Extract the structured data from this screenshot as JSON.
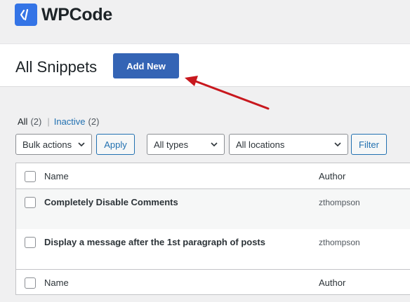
{
  "brand": {
    "logo_text_a": "WP",
    "logo_text_b": "Code",
    "accent": "#3474e6"
  },
  "header": {
    "title": "All Snippets",
    "add_new_label": "Add New",
    "button_color": "#3464b5"
  },
  "annotation": {
    "arrow_color": "#c8181e"
  },
  "filters": {
    "all_label": "All",
    "all_count": "(2)",
    "separator": "|",
    "inactive_label": "Inactive",
    "inactive_count": "(2)"
  },
  "toolbar": {
    "bulk_actions": "Bulk actions",
    "apply_label": "Apply",
    "types": "All types",
    "locations": "All locations",
    "filter_label": "Filter"
  },
  "table": {
    "columns": {
      "name": "Name",
      "author": "Author"
    },
    "rows": [
      {
        "name": "Completely Disable Comments",
        "author": "zthompson"
      },
      {
        "name": "Display a message after the 1st paragraph of posts",
        "author": "zthompson"
      }
    ]
  }
}
